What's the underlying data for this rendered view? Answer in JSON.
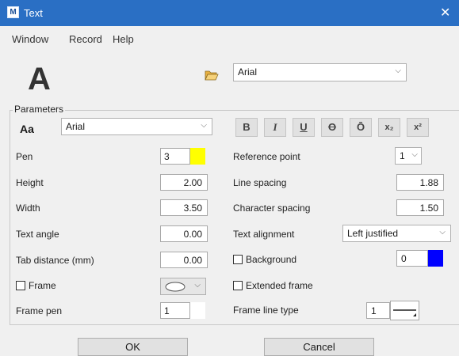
{
  "window": {
    "title": "Text",
    "icon_letter": "M"
  },
  "menu": [
    "Window",
    "Record",
    "Help"
  ],
  "preview_letter": "A",
  "top_font": {
    "value": "Arial"
  },
  "parameters": {
    "label": "Parameters",
    "aa": "Aa",
    "font": "Arial",
    "pen": {
      "label": "Pen",
      "value": "3",
      "color": "#ffff00"
    },
    "height": {
      "label": "Height",
      "value": "2.00"
    },
    "width": {
      "label": "Width",
      "value": "3.50"
    },
    "text_angle": {
      "label": "Text angle",
      "value": "0.00"
    },
    "tab_distance": {
      "label": "Tab distance (mm)",
      "value": "0.00"
    },
    "frame": {
      "label": "Frame",
      "checked": false
    },
    "frame_pen": {
      "label": "Frame pen",
      "value": "1"
    },
    "format_buttons": [
      "B",
      "I",
      "U",
      "O",
      "Ō",
      "x₂",
      "x²"
    ],
    "reference_point": {
      "label": "Reference point",
      "value": "1"
    },
    "line_spacing": {
      "label": "Line spacing",
      "value": "1.88"
    },
    "character_spacing": {
      "label": "Character spacing",
      "value": "1.50"
    },
    "text_alignment": {
      "label": "Text alignment",
      "value": "Left justified"
    },
    "background": {
      "label": "Background",
      "checked": false,
      "value": "0",
      "color": "#0000ff"
    },
    "extended_frame": {
      "label": "Extended frame",
      "checked": false
    },
    "frame_line_type": {
      "label": "Frame line type",
      "value": "1"
    }
  },
  "buttons": {
    "ok": "OK",
    "cancel": "Cancel"
  }
}
